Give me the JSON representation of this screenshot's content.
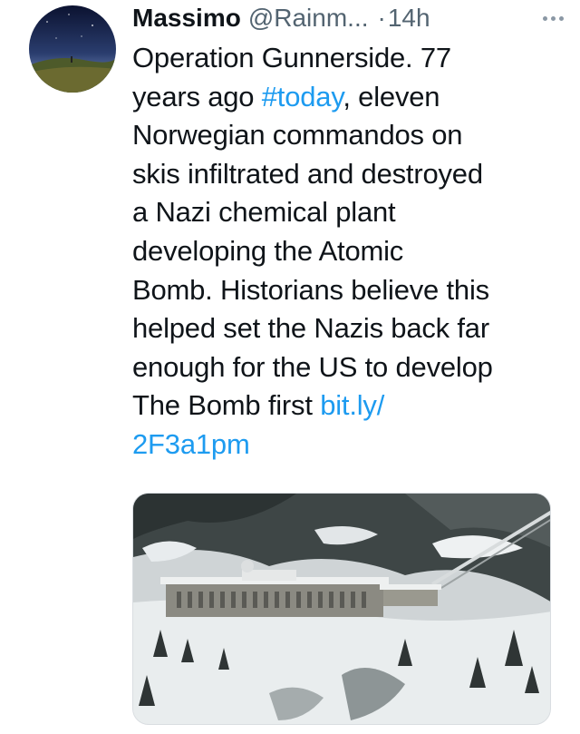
{
  "tweet": {
    "author_name": "Massimo",
    "handle": "@Rainm...",
    "separator": "·",
    "time": "14h",
    "text_lines": [
      [
        "Operation Gunnerside. 77",
        ""
      ],
      [
        "years ago ",
        "#today",
        ", eleven"
      ],
      [
        "Norwegian commandos on"
      ],
      [
        "skis infiltrated and destroyed"
      ],
      [
        "a Nazi chemical plant"
      ],
      [
        "developing the Atomic"
      ],
      [
        "Bomb. Historians believe this"
      ],
      [
        "helped set the Nazis back far"
      ],
      [
        "enough for the US to develop"
      ],
      [
        "The Bomb first ",
        "bit.ly/"
      ],
      [
        "2F3a1pm"
      ]
    ],
    "text": {
      "l1": "Operation Gunnerside. 77",
      "l2a": "years ago ",
      "hashtag": "#today",
      "l2b": ", eleven",
      "l3": "Norwegian commandos on",
      "l4": "skis infiltrated and destroyed",
      "l5": "a Nazi chemical plant",
      "l6": "developing the Atomic",
      "l7": "Bomb. Historians believe this",
      "l8": "helped set the Nazis back far",
      "l9": "enough for the US to develop",
      "l10a": "The Bomb first ",
      "link_part1": "bit.ly/",
      "link_part2": "2F3a1pm"
    },
    "more_icon": "more-dots-icon",
    "avatar_icon": "avatar-night-sky",
    "media_icon": "snowy-plant-photo",
    "colors": {
      "link": "#1d9bf0",
      "text": "#0f1419",
      "secondary": "#536471"
    }
  }
}
